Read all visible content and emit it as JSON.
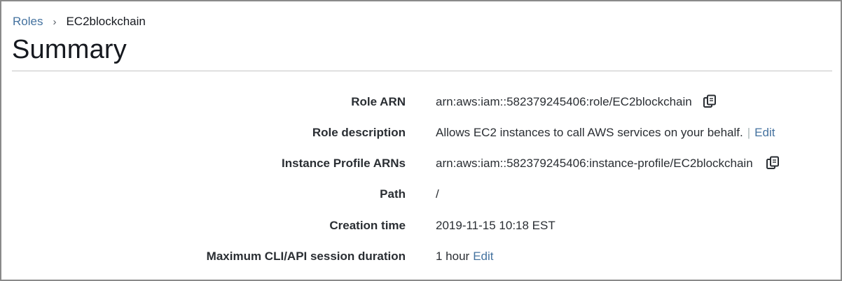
{
  "breadcrumb": {
    "parent": "Roles",
    "separator": "›",
    "current": "EC2blockchain"
  },
  "page_title": "Summary",
  "rows": [
    {
      "label": "Role ARN",
      "value": "arn:aws:iam::582379245406:role/EC2blockchain",
      "copy_icon": "copy-icon"
    },
    {
      "label": "Role description",
      "value": "Allows EC2 instances to call AWS services on your behalf.",
      "separator": "|",
      "edit": "Edit"
    },
    {
      "label": "Instance Profile ARNs",
      "value": "arn:aws:iam::582379245406:instance-profile/EC2blockchain",
      "copy_icon": "copy-icon"
    },
    {
      "label": "Path",
      "value": "/"
    },
    {
      "label": "Creation time",
      "value": "2019-11-15 10:18 EST"
    },
    {
      "label": "Maximum CLI/API session duration",
      "value": "1 hour",
      "edit": "Edit"
    }
  ],
  "colors": {
    "link": "#44729f",
    "text": "#16191f",
    "border": "#8a8a8a",
    "divider": "#c5c5c5"
  }
}
